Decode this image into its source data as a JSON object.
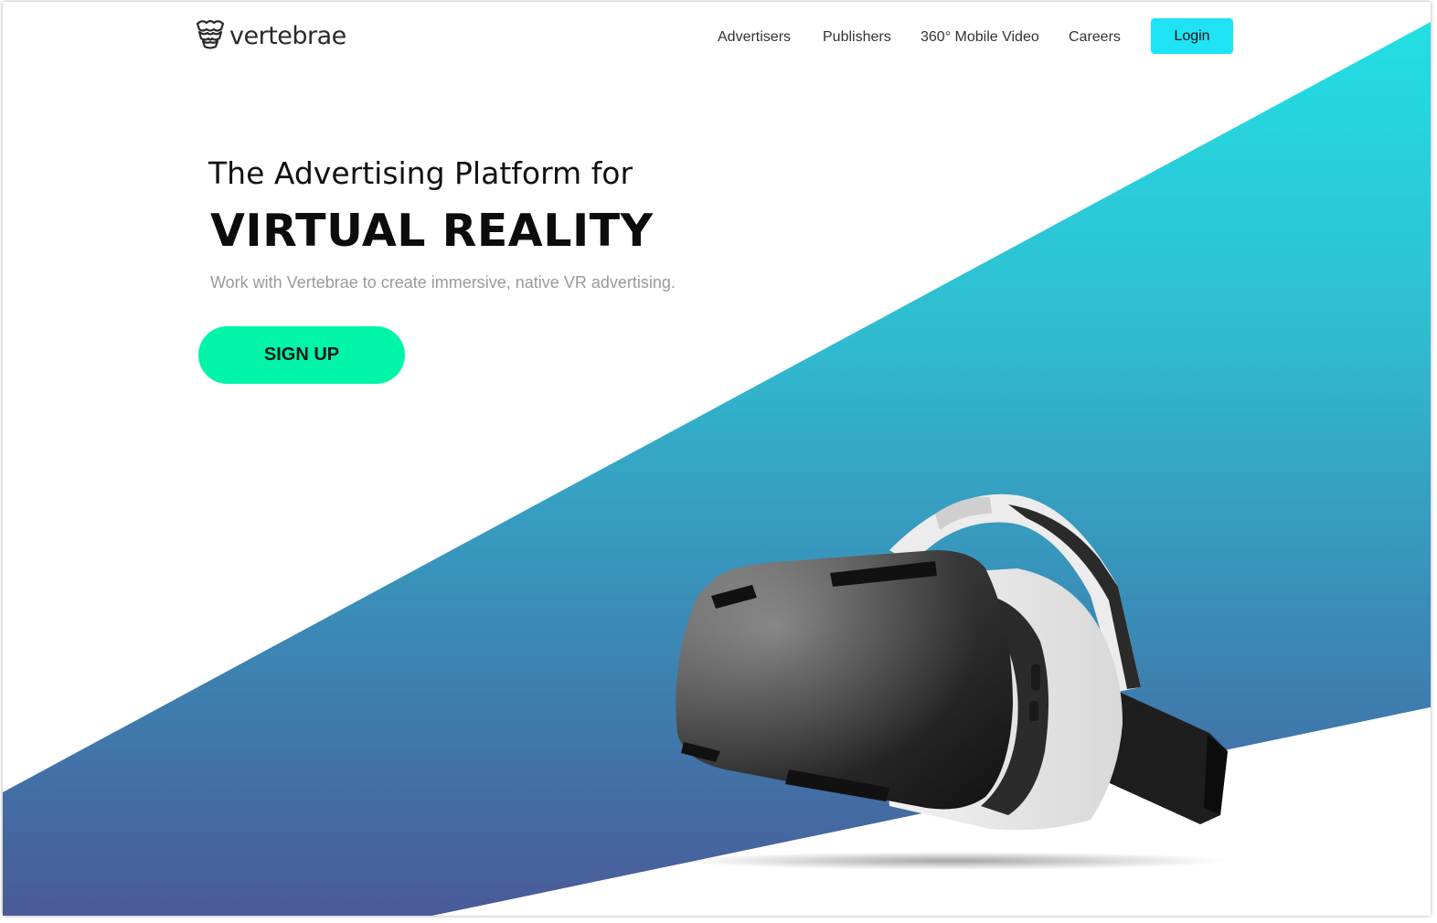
{
  "brand": {
    "logo_text": "vertebrae",
    "logo_icon": "vertebrae-logo-icon"
  },
  "nav": {
    "items": [
      {
        "label": "Advertisers"
      },
      {
        "label": "Publishers"
      },
      {
        "label": "360° Mobile Video"
      },
      {
        "label": "Careers"
      }
    ],
    "login_label": "Login"
  },
  "hero": {
    "pretitle": "The Advertising Platform for",
    "title": "VIRTUAL REALITY",
    "subtitle": "Work with Vertebrae to create immersive,  native VR advertising.",
    "cta_label": "SIGN UP"
  },
  "visual": {
    "image": "vr-headset-illustration"
  },
  "colors": {
    "accent_cyan": "#1ee3f5",
    "cta_green": "#00f5a8",
    "gradient_top": "#22dfe4",
    "gradient_bottom": "#4a5a98"
  }
}
